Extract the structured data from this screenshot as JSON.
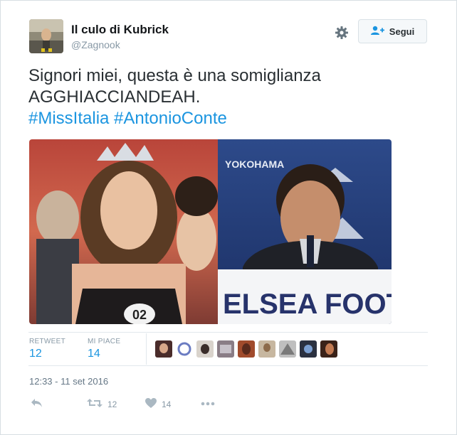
{
  "user": {
    "display_name": "Il culo di Kubrick",
    "handle": "@Zagnook"
  },
  "header": {
    "follow_label": "Segui"
  },
  "tweet": {
    "line1": "Signori miei, questa è una somiglianza",
    "line2": "AGGHIACCIANDEAH.",
    "hashtag1": "#MissItalia",
    "hashtag2": "#AntonioConte"
  },
  "media": {
    "left_badge": "02",
    "right_banner": "ELSEA FOOT",
    "right_backdrop": "YOKOHAMA"
  },
  "stats": {
    "retweet_label": "RETWEET",
    "retweet_count": "12",
    "likes_label": "MI PIACE",
    "likes_count": "14"
  },
  "timestamp": "12:33 - 11 set 2016",
  "actions": {
    "retweet_count": "12",
    "like_count": "14"
  },
  "colors": {
    "link": "#1b95e0",
    "text": "#292f33",
    "muted": "#8899a6"
  }
}
